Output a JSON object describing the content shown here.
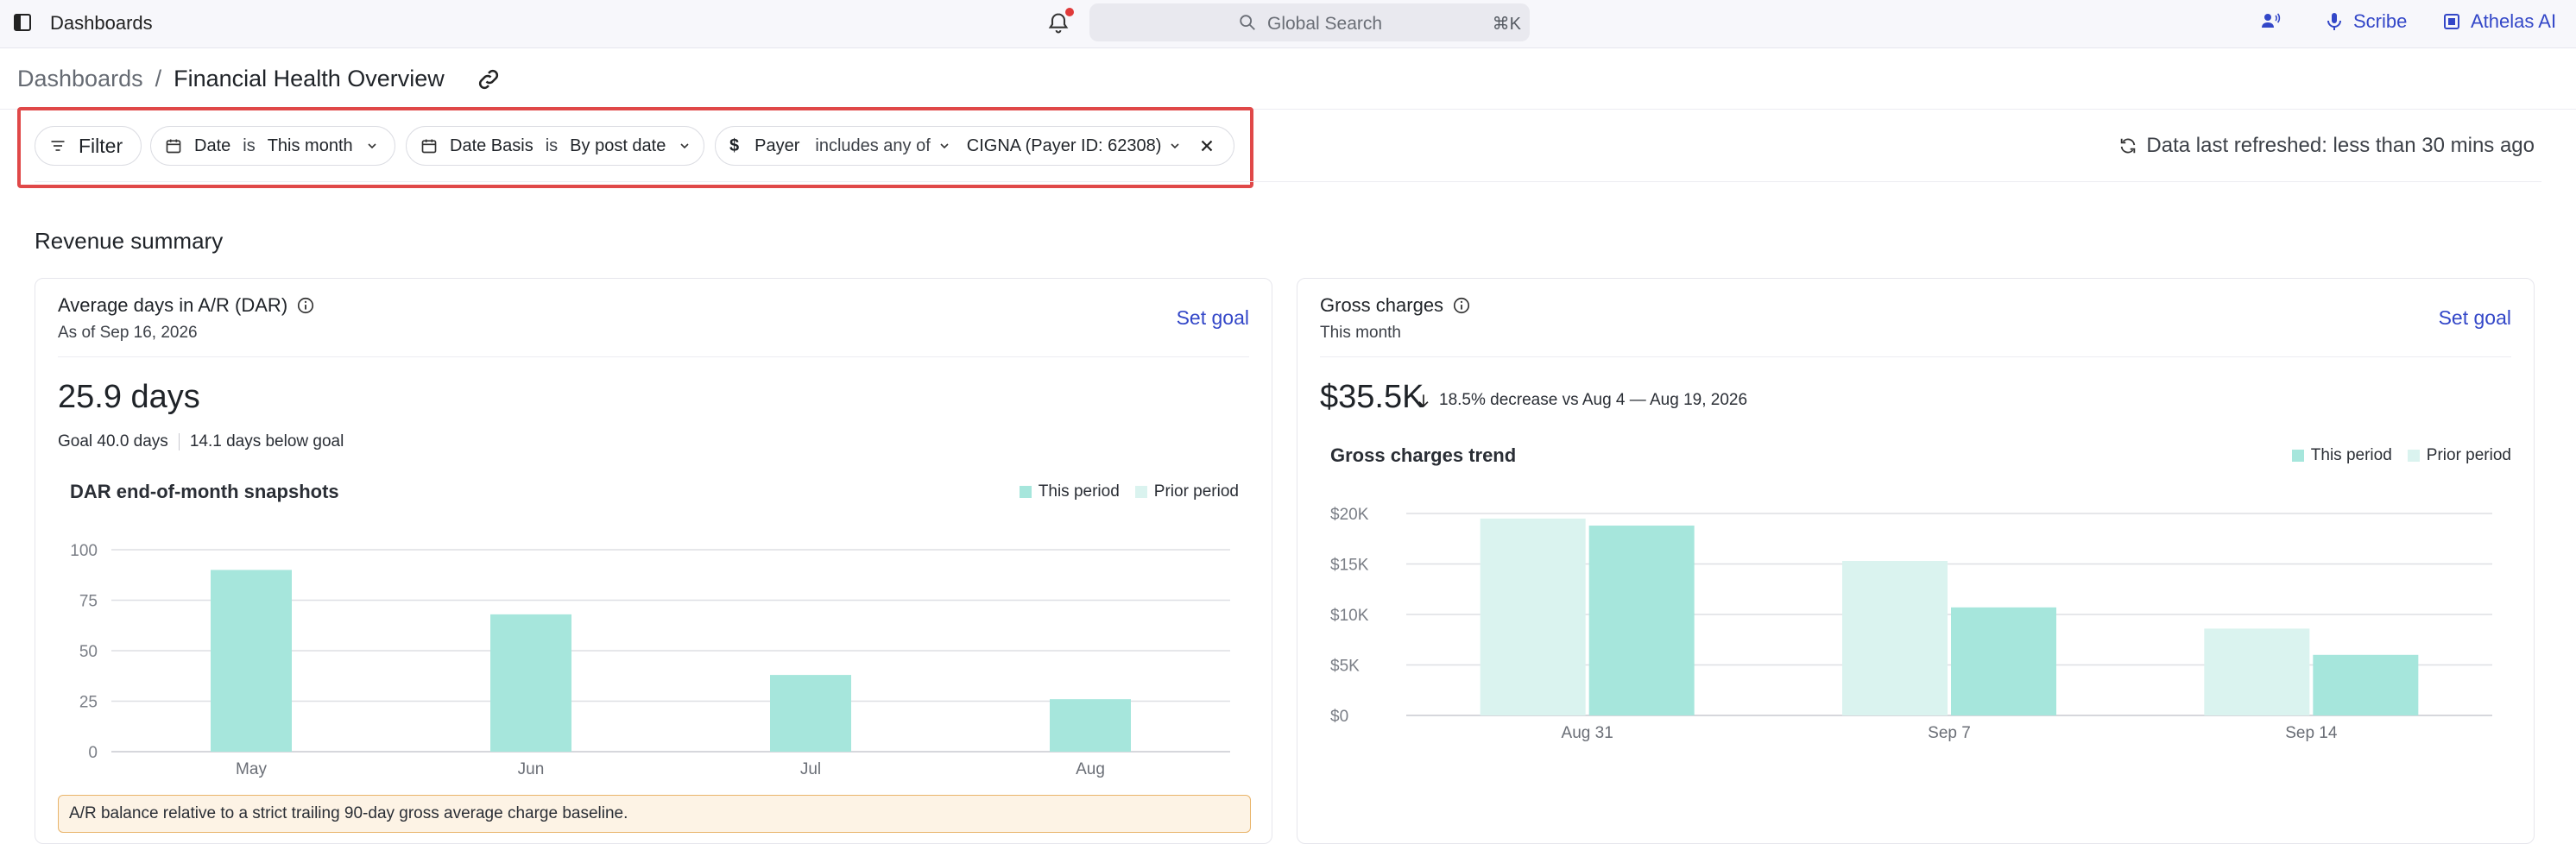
{
  "topbar": {
    "title": "Dashboards",
    "search_placeholder": "Global Search",
    "search_shortcut": "⌘K",
    "scribe_label": "Scribe",
    "ai_label": "Athelas AI"
  },
  "breadcrumb": {
    "root": "Dashboards",
    "separator": "/",
    "current": "Financial Health Overview"
  },
  "filters": {
    "filter_button": "Filter",
    "date": {
      "key": "Date",
      "op": "is",
      "value": "This month"
    },
    "date_basis": {
      "key": "Date Basis",
      "op": "is",
      "value": "By post date"
    },
    "payer": {
      "key": "Payer",
      "op": "includes any of",
      "value": "CIGNA (Payer ID: 62308)"
    },
    "refresh_text": "Data last refreshed: less than 30 mins ago"
  },
  "section_title": "Revenue summary",
  "dar_card": {
    "title": "Average days in A/R (DAR)",
    "subtitle": "As of Sep 16, 2026",
    "set_goal": "Set goal",
    "metric": "25.9 days",
    "goal_text": "Goal 40.0 days",
    "goal_delta": "14.1 days below goal",
    "note": "A/R balance relative to a strict trailing 90-day gross average charge baseline."
  },
  "gross_card": {
    "title": "Gross charges",
    "subtitle": "This month",
    "set_goal": "Set goal",
    "metric": "$35.5K",
    "delta_text": "18.5% decrease vs Aug 4 — Aug 19, 2026"
  },
  "colors": {
    "this_period": "#a6e6dc",
    "prior_period": "#daf3ef",
    "accent": "#3347c8",
    "highlight": "#e04848"
  },
  "chart_data": [
    {
      "type": "bar",
      "title": "DAR end-of-month snapshots",
      "categories": [
        "May",
        "Jun",
        "Jul",
        "Aug"
      ],
      "series": [
        {
          "name": "This period",
          "values": [
            90,
            68,
            38,
            26
          ]
        },
        {
          "name": "Prior period",
          "values": [
            0,
            0,
            0,
            0
          ]
        }
      ],
      "yticks": [
        "0",
        "25",
        "50",
        "75",
        "100"
      ],
      "ylim": [
        0,
        100
      ],
      "legend": "top-right",
      "grid": true
    },
    {
      "type": "bar",
      "title": "Gross charges trend",
      "categories": [
        "Aug 31",
        "Sep 7",
        "Sep 14"
      ],
      "series": [
        {
          "name": "This period",
          "values": [
            18.8,
            10.7,
            6.0
          ]
        },
        {
          "name": "Prior period",
          "values": [
            19.5,
            15.3,
            8.6
          ]
        }
      ],
      "yticks": [
        "$0",
        "$5K",
        "$10K",
        "$15K",
        "$20K"
      ],
      "ylim": [
        0,
        20
      ],
      "legend": "top-right",
      "grid": true
    }
  ]
}
